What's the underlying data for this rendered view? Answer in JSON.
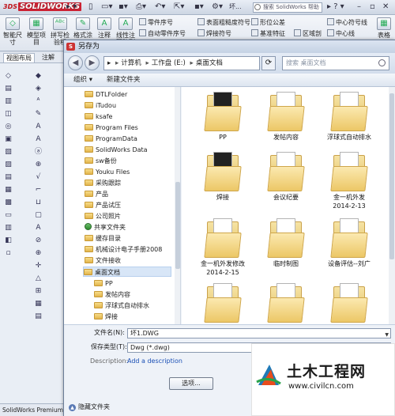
{
  "solidworks": {
    "logo": "SOLIDWORKS",
    "title_short": "坏...",
    "help_search_placeholder": "搜索 SolidWorks 帮助",
    "status_text": "SolidWorks Premium"
  },
  "ribbon": {
    "big_buttons": [
      {
        "label": "智能尺\n寸"
      },
      {
        "label": "模型项\n目"
      },
      {
        "label": "拼写检\n验程"
      },
      {
        "label": "格式涂"
      },
      {
        "label": "注释"
      },
      {
        "label": "线性注\n释阵列"
      }
    ],
    "small_items": [
      {
        "label": "零件序号"
      },
      {
        "label": "自动零件序号"
      },
      {
        "label": "表面粗糙度符号"
      },
      {
        "label": "焊接符号"
      },
      {
        "label": "形位公差"
      },
      {
        "label": "基准特征"
      },
      {
        "label": "区域剖"
      },
      {
        "label": "中心符号线"
      },
      {
        "label": "中心线"
      },
      {
        "label": "表格"
      }
    ]
  },
  "left_panel": {
    "tabs": [
      "视图布局",
      "注解"
    ]
  },
  "dialog": {
    "title": "另存为",
    "address": [
      "计算机",
      "工作盘 (E:)",
      "桌面文档"
    ],
    "search_placeholder": "搜索 桌面文档",
    "commands": {
      "organize": "组织 ▾",
      "new_folder": "新建文件夹"
    },
    "tree": [
      {
        "label": "DTLFolder"
      },
      {
        "label": "iTudou"
      },
      {
        "label": "ksafe"
      },
      {
        "label": "Program Files"
      },
      {
        "label": "ProgramData"
      },
      {
        "label": "SolidWorks Data"
      },
      {
        "label": "sw备份"
      },
      {
        "label": "Youku Files"
      },
      {
        "label": "采购跟踪"
      },
      {
        "label": "产品"
      },
      {
        "label": "产品试压"
      },
      {
        "label": "公司照片"
      },
      {
        "label": "共享文件夹"
      },
      {
        "label": "缓存目录"
      },
      {
        "label": "机械设计电子手册2008"
      },
      {
        "label": "文件接收"
      },
      {
        "label": "桌面文档"
      },
      {
        "label": "PP"
      },
      {
        "label": "发帖内容"
      },
      {
        "label": "浮球式自动排水"
      },
      {
        "label": "焊接"
      }
    ],
    "items": [
      {
        "label": "PP"
      },
      {
        "label": "发帖内容"
      },
      {
        "label": "浮球式自动排水"
      },
      {
        "label": "焊接"
      },
      {
        "label": "会议纪要"
      },
      {
        "label": "金一机外发\n2014-2-13"
      },
      {
        "label": "金一机外发修改\n2014-2-15"
      },
      {
        "label": "临时制图"
      },
      {
        "label": "设备评估--刘广"
      },
      {
        "label": ""
      },
      {
        "label": ""
      },
      {
        "label": ""
      }
    ],
    "form": {
      "filename_label": "文件名(N):",
      "filename_value": "坏1.DWG",
      "savetype_label": "保存类型(T):",
      "savetype_value": "Dwg (*.dwg)",
      "description_label": "Description:",
      "description_link": "Add a description",
      "options_button": "选项...",
      "hide_folders": "隐藏文件夹"
    }
  },
  "watermark": {
    "title": "土木工程网",
    "url": "www.civilcn.com"
  }
}
